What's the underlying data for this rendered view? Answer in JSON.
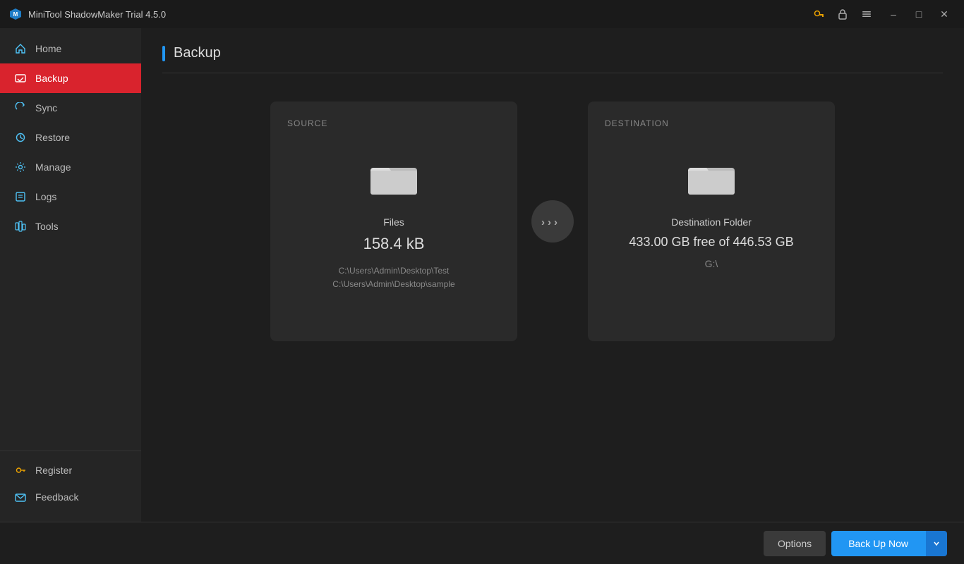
{
  "app": {
    "title": "MiniTool ShadowMaker Trial 4.5.0"
  },
  "titlebar": {
    "icons": [
      "key",
      "lock",
      "menu"
    ],
    "controls": [
      "minimize",
      "restore",
      "close"
    ]
  },
  "sidebar": {
    "nav_items": [
      {
        "id": "home",
        "label": "Home",
        "icon": "home"
      },
      {
        "id": "backup",
        "label": "Backup",
        "icon": "backup",
        "active": true
      },
      {
        "id": "sync",
        "label": "Sync",
        "icon": "sync"
      },
      {
        "id": "restore",
        "label": "Restore",
        "icon": "restore"
      },
      {
        "id": "manage",
        "label": "Manage",
        "icon": "manage"
      },
      {
        "id": "logs",
        "label": "Logs",
        "icon": "logs"
      },
      {
        "id": "tools",
        "label": "Tools",
        "icon": "tools"
      }
    ],
    "bottom_items": [
      {
        "id": "register",
        "label": "Register",
        "icon": "key"
      },
      {
        "id": "feedback",
        "label": "Feedback",
        "icon": "mail"
      }
    ]
  },
  "page": {
    "title": "Backup"
  },
  "source_card": {
    "section_label": "SOURCE",
    "type_label": "Files",
    "size": "158.4 kB",
    "paths": [
      "C:\\Users\\Admin\\Desktop\\Test",
      "C:\\Users\\Admin\\Desktop\\sample"
    ]
  },
  "destination_card": {
    "section_label": "DESTINATION",
    "type_label": "Destination Folder",
    "free_space": "433.00 GB free of 446.53 GB",
    "drive": "G:\\"
  },
  "bottom_bar": {
    "options_label": "Options",
    "backup_now_label": "Back Up Now"
  }
}
